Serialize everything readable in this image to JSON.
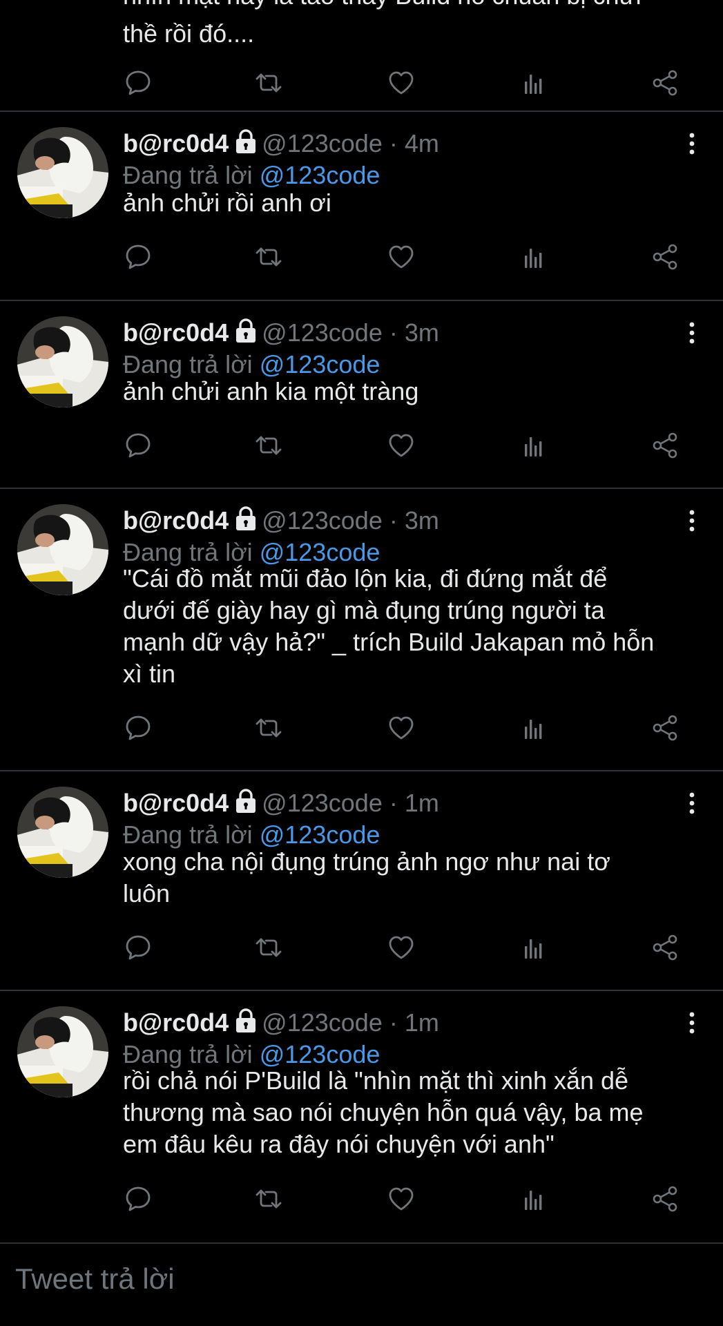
{
  "partial_tweet": {
    "cut_text": "nhìn mặt hay là tao thấy Build nó chuẩn bị chửi",
    "body": "thề rồi đó...."
  },
  "tweets": [
    {
      "name": "b@rc0d4",
      "handle": "@123code",
      "separator": "·",
      "time": "4m",
      "replying_prefix": "Đang trả lời",
      "replying_to": "@123code",
      "text": "ảnh chửi rồi anh ơi"
    },
    {
      "name": "b@rc0d4",
      "handle": "@123code",
      "separator": "·",
      "time": "3m",
      "replying_prefix": "Đang trả lời",
      "replying_to": "@123code",
      "text": "ảnh chửi anh kia một tràng"
    },
    {
      "name": "b@rc0d4",
      "handle": "@123code",
      "separator": "·",
      "time": "3m",
      "replying_prefix": "Đang trả lời",
      "replying_to": "@123code",
      "text": "\"Cái đồ mắt mũi đảo lộn kia, đi đứng mắt để\ndưới đế giày hay gì mà đụng trúng người ta\nmạnh dữ vậy hả?\" _ trích Build Jakapan mỏ hỗn\nxì tin"
    },
    {
      "name": "b@rc0d4",
      "handle": "@123code",
      "separator": "·",
      "time": "1m",
      "replying_prefix": "Đang trả lời",
      "replying_to": "@123code",
      "text": "xong cha nội đụng trúng ảnh ngơ như nai tơ\nluôn"
    },
    {
      "name": "b@rc0d4",
      "handle": "@123code",
      "separator": "·",
      "time": "1m",
      "replying_prefix": "Đang trả lời",
      "replying_to": "@123code",
      "text": "rồi chả nói P'Build là \"nhìn mặt thì xinh xắn dễ\nthương mà sao nói chuyện hỗn quá vậy, ba mẹ\nem đâu kêu ra đây nói chuyện với anh\""
    }
  ],
  "icons": {
    "reply": "reply-icon",
    "retweet": "retweet-icon",
    "like": "like-icon",
    "stats": "stats-icon",
    "share": "share-icon",
    "lock": "lock-icon",
    "more": "more-icon"
  },
  "composer": {
    "placeholder": "Tweet trả lời"
  },
  "colors": {
    "background": "#000000",
    "text": "#e7e9ea",
    "secondary": "#71767b",
    "mention": "#4a99e9",
    "divider": "#2f3336"
  }
}
